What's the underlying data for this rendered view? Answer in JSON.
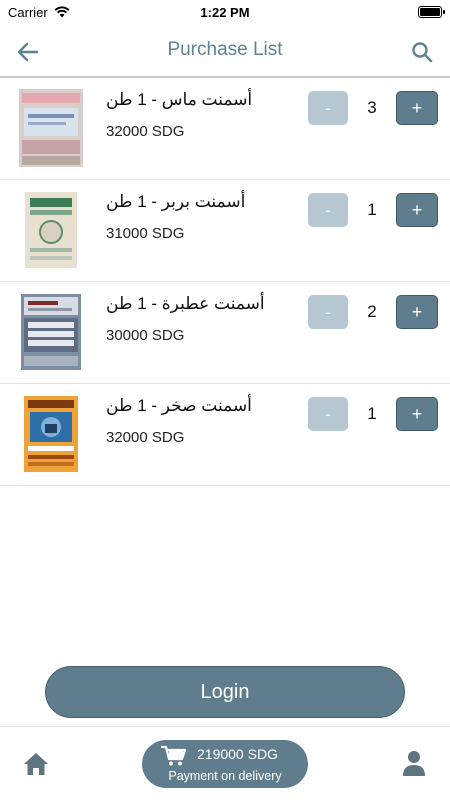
{
  "status_bar": {
    "carrier": "Carrier",
    "time": "1:22 PM"
  },
  "header": {
    "title": "Purchase List"
  },
  "products": [
    {
      "name": "أسمنت ماس - 1 طن",
      "price": "32000 SDG",
      "qty": "3",
      "minus": "-",
      "plus": "+"
    },
    {
      "name": "أسمنت بربر - 1 طن",
      "price": "31000 SDG",
      "qty": "1",
      "minus": "-",
      "plus": "+"
    },
    {
      "name": "أسمنت عطبرة - 1 طن",
      "price": "30000 SDG",
      "qty": "2",
      "minus": "-",
      "plus": "+"
    },
    {
      "name": "أسمنت صخر - 1 طن",
      "price": "32000 SDG",
      "qty": "1",
      "minus": "-",
      "plus": "+"
    }
  ],
  "login_label": "Login",
  "cart": {
    "total": "219000 SDG",
    "subtitle": "Payment on delivery"
  },
  "colors": {
    "accent": "#5f7d8c",
    "accent_light": "#b7c7d1",
    "title": "#5e8394"
  },
  "icons": {
    "back": "arrow-left-icon",
    "search": "search-icon",
    "home": "home-icon",
    "cart": "cart-icon",
    "profile": "user-icon"
  }
}
